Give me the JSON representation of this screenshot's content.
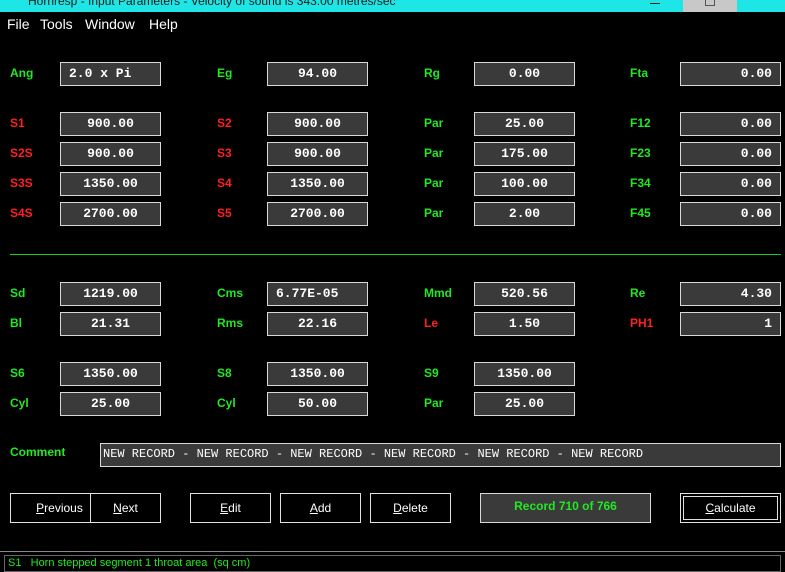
{
  "window": {
    "title": "Hornresp - Input Parameters - Velocity of sound is 343.00 metres/sec",
    "colors": {
      "titlebar": "#1fe6e6",
      "label_green": "#22e822",
      "label_red": "#ff2020",
      "field_bg": "#3a3a3a"
    }
  },
  "menu": [
    "File",
    "Tools",
    "Window",
    "Help"
  ],
  "rows_top": [
    {
      "cells": [
        {
          "label": "Ang",
          "color": "green",
          "value": "2.0 x Pi",
          "align": "left"
        },
        {
          "label": "Eg",
          "color": "green",
          "value": "94.00"
        },
        {
          "label": "Rg",
          "color": "green",
          "value": "0.00"
        },
        {
          "label": "Fta",
          "color": "green",
          "value": "0.00"
        }
      ]
    },
    {
      "cells": [
        {
          "label": "S1",
          "color": "red",
          "value": "900.00"
        },
        {
          "label": "S2",
          "color": "red",
          "value": "900.00"
        },
        {
          "label": "Par",
          "color": "green",
          "value": "25.00"
        },
        {
          "label": "F12",
          "color": "green",
          "value": "0.00"
        }
      ]
    },
    {
      "cells": [
        {
          "label": "S2S",
          "color": "red",
          "value": "900.00"
        },
        {
          "label": "S3",
          "color": "red",
          "value": "900.00"
        },
        {
          "label": "Par",
          "color": "green",
          "value": "175.00"
        },
        {
          "label": "F23",
          "color": "green",
          "value": "0.00"
        }
      ]
    },
    {
      "cells": [
        {
          "label": "S3S",
          "color": "red",
          "value": "1350.00"
        },
        {
          "label": "S4",
          "color": "red",
          "value": "1350.00"
        },
        {
          "label": "Par",
          "color": "green",
          "value": "100.00"
        },
        {
          "label": "F34",
          "color": "green",
          "value": "0.00"
        }
      ]
    },
    {
      "cells": [
        {
          "label": "S4S",
          "color": "red",
          "value": "2700.00"
        },
        {
          "label": "S5",
          "color": "red",
          "value": "2700.00"
        },
        {
          "label": "Par",
          "color": "green",
          "value": "2.00"
        },
        {
          "label": "F45",
          "color": "green",
          "value": "0.00"
        }
      ]
    }
  ],
  "rows_bottom": [
    {
      "cells": [
        {
          "label": "Sd",
          "color": "green",
          "value": "1219.00"
        },
        {
          "label": "Cms",
          "color": "green",
          "value": "6.77E-05",
          "align": "left"
        },
        {
          "label": "Mmd",
          "color": "green",
          "value": "520.56"
        },
        {
          "label": "Re",
          "color": "green",
          "value": "4.30"
        }
      ]
    },
    {
      "cells": [
        {
          "label": "Bl",
          "color": "green",
          "value": "21.31"
        },
        {
          "label": "Rms",
          "color": "green",
          "value": "22.16"
        },
        {
          "label": "Le",
          "color": "red",
          "value": "1.50"
        },
        {
          "label": "PH1",
          "color": "red",
          "value": "1"
        }
      ]
    },
    {
      "cells": [
        {
          "label": "S6",
          "color": "green",
          "value": "1350.00"
        },
        {
          "label": "S8",
          "color": "green",
          "value": "1350.00"
        },
        {
          "label": "S9",
          "color": "green",
          "value": "1350.00"
        }
      ]
    },
    {
      "cells": [
        {
          "label": "Cyl",
          "color": "green",
          "value": "25.00"
        },
        {
          "label": "Cyl",
          "color": "green",
          "value": "50.00"
        },
        {
          "label": "Par",
          "color": "green",
          "value": "25.00"
        }
      ]
    }
  ],
  "comment": {
    "label": "Comment",
    "value": "NEW RECORD - NEW RECORD - NEW RECORD - NEW RECORD - NEW RECORD - NEW RECORD"
  },
  "buttons": {
    "previous": {
      "key": "P",
      "rest": "revious"
    },
    "next": {
      "key": "N",
      "rest": "ext"
    },
    "edit": {
      "key": "E",
      "rest": "dit"
    },
    "add": {
      "key": "A",
      "rest": "dd"
    },
    "delete": {
      "key": "D",
      "rest": "elete"
    },
    "calculate": {
      "key": "C",
      "rest": "alculate"
    }
  },
  "record_label": "Record 710 of 766",
  "status": "S1   Horn stepped segment 1 throat area  (sq cm)"
}
